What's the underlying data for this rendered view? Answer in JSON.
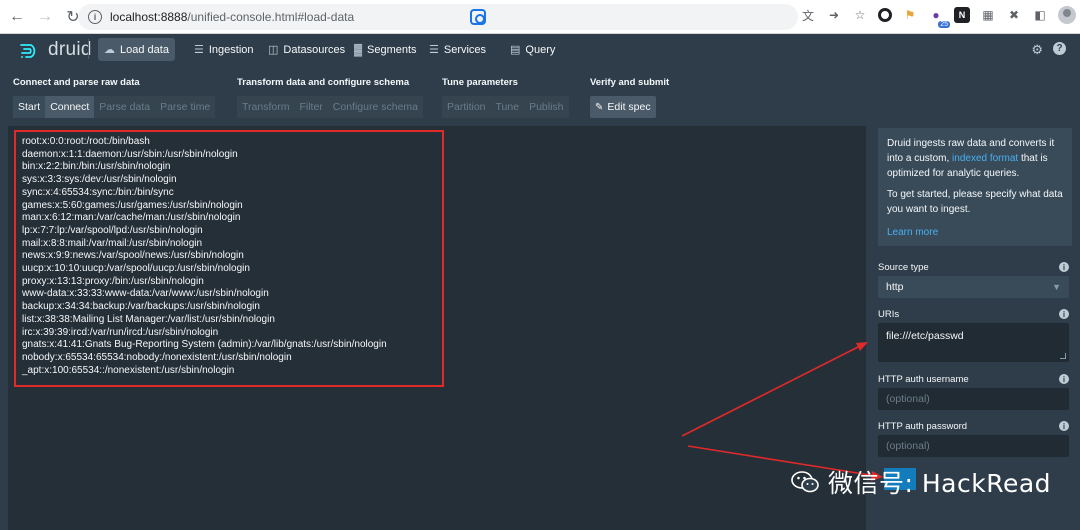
{
  "browser": {
    "url_host": "localhost:8888",
    "url_path": "/unified-console.html#load-data",
    "extension_badge": "25"
  },
  "header": {
    "logo_text": "druid",
    "nav": [
      {
        "label": "Load data",
        "icon": "cloud-upload-icon",
        "active": true
      },
      {
        "label": "Ingestion",
        "icon": "gantt-icon"
      },
      {
        "label": "Datasources",
        "icon": "layers-icon"
      },
      {
        "label": "Segments",
        "icon": "segments-icon"
      },
      {
        "label": "Services",
        "icon": "database-icon"
      },
      {
        "label": "Query",
        "icon": "application-icon"
      }
    ]
  },
  "steps": {
    "groups": [
      {
        "title": "Connect and parse raw data",
        "buttons": [
          "Start",
          "Connect",
          "Parse data",
          "Parse time"
        ]
      },
      {
        "title": "Transform data and configure schema",
        "buttons": [
          "Transform",
          "Filter",
          "Configure schema"
        ]
      },
      {
        "title": "Tune parameters",
        "buttons": [
          "Partition",
          "Tune",
          "Publish"
        ]
      },
      {
        "title": "Verify and submit",
        "buttons": [
          "Edit spec"
        ]
      }
    ]
  },
  "raw_data": {
    "lines": [
      "root:x:0:0:root:/root:/bin/bash",
      "daemon:x:1:1:daemon:/usr/sbin:/usr/sbin/nologin",
      "bin:x:2:2:bin:/bin:/usr/sbin/nologin",
      "sys:x:3:3:sys:/dev:/usr/sbin/nologin",
      "sync:x:4:65534:sync:/bin:/bin/sync",
      "games:x:5:60:games:/usr/games:/usr/sbin/nologin",
      "man:x:6:12:man:/var/cache/man:/usr/sbin/nologin",
      "lp:x:7:7:lp:/var/spool/lpd:/usr/sbin/nologin",
      "mail:x:8:8:mail:/var/mail:/usr/sbin/nologin",
      "news:x:9:9:news:/var/spool/news:/usr/sbin/nologin",
      "uucp:x:10:10:uucp:/var/spool/uucp:/usr/sbin/nologin",
      "proxy:x:13:13:proxy:/bin:/usr/sbin/nologin",
      "www-data:x:33:33:www-data:/var/www:/usr/sbin/nologin",
      "backup:x:34:34:backup:/var/backups:/usr/sbin/nologin",
      "list:x:38:38:Mailing List Manager:/var/list:/usr/sbin/nologin",
      "irc:x:39:39:ircd:/var/run/ircd:/usr/sbin/nologin",
      "gnats:x:41:41:Gnats Bug-Reporting System (admin):/var/lib/gnats:/usr/sbin/nologin",
      "nobody:x:65534:65534:nobody:/nonexistent:/usr/sbin/nologin",
      "_apt:x:100:65534::/nonexistent:/usr/sbin/nologin"
    ]
  },
  "sidebar": {
    "intro_before": "Druid ingests raw data and converts it into a custom, ",
    "intro_link": "indexed format",
    "intro_after": " that is optimized for analytic queries.",
    "intro_2": "To get started, please specify what data you want to ingest.",
    "learn_more": "Learn more",
    "source_type_label": "Source type",
    "source_type_value": "http",
    "uris_label": "URIs",
    "uris_value": "file:///etc/passwd",
    "auth_user_label": "HTTP auth username",
    "auth_user_placeholder": "(optional)",
    "auth_pass_label": "HTTP auth password",
    "auth_pass_placeholder": "(optional)"
  },
  "watermark": {
    "text": "微信号: HackRead"
  },
  "colors": {
    "background": "#2f3d4a",
    "panel": "#252f38",
    "highlight_red": "#e02929",
    "link_blue": "#48aff0"
  }
}
